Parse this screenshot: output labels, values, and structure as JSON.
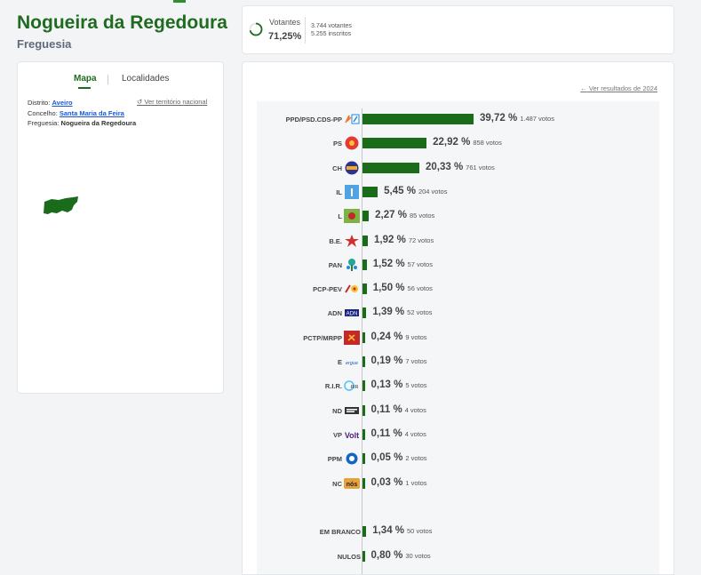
{
  "header": {
    "title": "Nogueira da Regedoura",
    "subtitle": "Freguesia"
  },
  "tabs": {
    "mapa": "Mapa",
    "localidades": "Localidades"
  },
  "info": {
    "distrito_label": "Distrito:",
    "distrito_value": "Aveiro",
    "concelho_label": "Concelho:",
    "concelho_value": "Santa Maria da Feira",
    "freguesia_label": "Freguesia:",
    "freguesia_value": "Nogueira da Regedoura",
    "ver_territorio": "Ver território nacional"
  },
  "votantes": {
    "label": "Votantes",
    "pct": "71,25%",
    "votantes_line": "3.744 votantes",
    "inscritos_line": "5.255 inscritos",
    "progress": 0.7125
  },
  "results": {
    "ver_link": "Ver resultados de 2024",
    "accent": "#1a6b1a"
  },
  "chart_data": {
    "type": "bar",
    "orientation": "horizontal",
    "categories": [
      "PPD/PSD.CDS-PP",
      "PS",
      "CH",
      "IL",
      "L",
      "B.E.",
      "PAN",
      "PCP-PEV",
      "ADN",
      "PCTP/MRPP",
      "E",
      "R.I.R.",
      "ND",
      "VP",
      "PPM",
      "NC",
      "EM BRANCO",
      "NULOS"
    ],
    "pct_labels": [
      "39,72 %",
      "22,92 %",
      "20,33 %",
      "5,45 %",
      "2,27 %",
      "1,92 %",
      "1,52 %",
      "1,50 %",
      "1,39 %",
      "0,24 %",
      "0,19 %",
      "0,13 %",
      "0,11 %",
      "0,11 %",
      "0,05 %",
      "0,03 %",
      "1,34 %",
      "0,80 %"
    ],
    "values": [
      39.72,
      22.92,
      20.33,
      5.45,
      2.27,
      1.92,
      1.52,
      1.5,
      1.39,
      0.24,
      0.19,
      0.13,
      0.11,
      0.11,
      0.05,
      0.03,
      1.34,
      0.8
    ],
    "votes_labels": [
      "1.487 votos",
      "858 votos",
      "761 votos",
      "204 votos",
      "85 votos",
      "72 votos",
      "57 votos",
      "56 votos",
      "52 votos",
      "9 votos",
      "7 votos",
      "5 votos",
      "4 votos",
      "4 votos",
      "2 votos",
      "1 votos",
      "50 votos",
      "30 votos"
    ],
    "logo_names": [
      "ad-logo-icon",
      "ps-logo-icon",
      "chega-logo-icon",
      "il-logo-icon",
      "livre-logo-icon",
      "be-logo-icon",
      "pan-logo-icon",
      "cdu-logo-icon",
      "adn-logo-icon",
      "pctp-logo-icon",
      "e-logo-icon",
      "rir-logo-icon",
      "nd-logo-icon",
      "volt-logo-icon",
      "ppm-logo-icon",
      "nc-logo-icon",
      "",
      ""
    ]
  }
}
